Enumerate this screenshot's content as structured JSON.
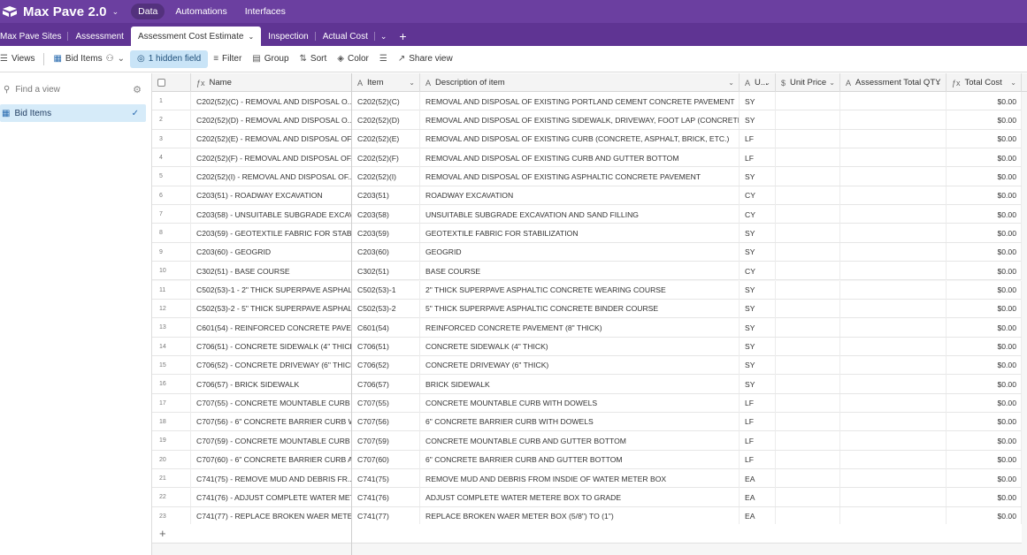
{
  "app": {
    "title": "Max Pave 2.0",
    "nav": [
      "Data",
      "Automations",
      "Interfaces"
    ],
    "active_nav": "Data"
  },
  "tabs": {
    "items": [
      "Max Pave Sites",
      "Assessment",
      "Assessment Cost Estimate",
      "Inspection",
      "Actual Cost"
    ],
    "active": "Assessment Cost Estimate"
  },
  "toolbar": {
    "views": "Views",
    "view_name": "Bid Items",
    "hidden": "1 hidden field",
    "filter": "Filter",
    "group": "Group",
    "sort": "Sort",
    "color": "Color",
    "share": "Share view"
  },
  "sidebar": {
    "search_placeholder": "Find a view",
    "view_item": "Bid Items"
  },
  "columns": {
    "name": "Name",
    "item": "Item",
    "description": "Description of item",
    "unit": "U...",
    "unit_price": "Unit Price",
    "qty": "Assessment Total QTY",
    "total": "Total Cost"
  },
  "rows": [
    {
      "n": "1",
      "name": "C202(52)(C) - REMOVAL AND DISPOSAL O...",
      "item": "C202(52)(C)",
      "desc": "REMOVAL AND DISPOSAL OF EXISTING PORTLAND CEMENT CONCRETE PAVEMENT",
      "unit": "SY",
      "cost": "$0.00"
    },
    {
      "n": "2",
      "name": "C202(52)(D) - REMOVAL AND DISPOSAL O...",
      "item": "C202(52)(D)",
      "desc": "REMOVAL AND DISPOSAL OF EXISTING SIDEWALK, DRIVEWAY, FOOT LAP (CONCRETE, BRI...",
      "unit": "SY",
      "cost": "$0.00"
    },
    {
      "n": "3",
      "name": "C202(52)(E) - REMOVAL AND DISPOSAL OF...",
      "item": "C202(52)(E)",
      "desc": "REMOVAL AND DISPOSAL OF EXISTING CURB (CONCRETE, ASPHALT, BRICK, ETC.)",
      "unit": "LF",
      "cost": "$0.00"
    },
    {
      "n": "4",
      "name": "C202(52)(F) - REMOVAL AND DISPOSAL OF...",
      "item": "C202(52)(F)",
      "desc": "REMOVAL AND DISPOSAL OF EXISTING CURB AND GUTTER BOTTOM",
      "unit": "LF",
      "cost": "$0.00"
    },
    {
      "n": "5",
      "name": "C202(52)(I) - REMOVAL AND DISPOSAL OF...",
      "item": "C202(52)(I)",
      "desc": "REMOVAL AND DISPOSAL OF EXISTING ASPHALTIC CONCRETE PAVEMENT",
      "unit": "SY",
      "cost": "$0.00"
    },
    {
      "n": "6",
      "name": "C203(51) - ROADWAY EXCAVATION",
      "item": "C203(51)",
      "desc": "ROADWAY EXCAVATION",
      "unit": "CY",
      "cost": "$0.00"
    },
    {
      "n": "7",
      "name": "C203(58) - UNSUITABLE SUBGRADE EXCAV...",
      "item": "C203(58)",
      "desc": "UNSUITABLE SUBGRADE EXCAVATION AND SAND FILLING",
      "unit": "CY",
      "cost": "$0.00"
    },
    {
      "n": "8",
      "name": "C203(59) - GEOTEXTILE FABRIC FOR STABIL...",
      "item": "C203(59)",
      "desc": "GEOTEXTILE FABRIC FOR STABILIZATION",
      "unit": "SY",
      "cost": "$0.00"
    },
    {
      "n": "9",
      "name": "C203(60) - GEOGRID",
      "item": "C203(60)",
      "desc": "GEOGRID",
      "unit": "SY",
      "cost": "$0.00"
    },
    {
      "n": "10",
      "name": "C302(51) - BASE COURSE",
      "item": "C302(51)",
      "desc": "BASE COURSE",
      "unit": "CY",
      "cost": "$0.00"
    },
    {
      "n": "11",
      "name": "C502(53)-1 - 2\" THICK SUPERPAVE ASPHAL...",
      "item": "C502(53)-1",
      "desc": "2\" THICK SUPERPAVE ASPHALTIC CONCRETE WEARING COURSE",
      "unit": "SY",
      "cost": "$0.00"
    },
    {
      "n": "12",
      "name": "C502(53)-2 - 5\" THICK SUPERPAVE ASPHAL...",
      "item": "C502(53)-2",
      "desc": "5\" THICK SUPERPAVE ASPHALTIC CONCRETE BINDER COURSE",
      "unit": "SY",
      "cost": "$0.00"
    },
    {
      "n": "13",
      "name": "C601(54) - REINFORCED CONCRETE PAVE...",
      "item": "C601(54)",
      "desc": "REINFORCED CONCRETE PAVEMENT (8\" THICK)",
      "unit": "SY",
      "cost": "$0.00"
    },
    {
      "n": "14",
      "name": "C706(51) - CONCRETE SIDEWALK (4\" THICK)",
      "item": "C706(51)",
      "desc": "CONCRETE SIDEWALK (4\" THICK)",
      "unit": "SY",
      "cost": "$0.00"
    },
    {
      "n": "15",
      "name": "C706(52) - CONCRETE DRIVEWAY (6\" THICK)",
      "item": "C706(52)",
      "desc": "CONCRETE DRIVEWAY (6\" THICK)",
      "unit": "SY",
      "cost": "$0.00"
    },
    {
      "n": "16",
      "name": "C706(57) - BRICK SIDEWALK",
      "item": "C706(57)",
      "desc": "BRICK SIDEWALK",
      "unit": "SY",
      "cost": "$0.00"
    },
    {
      "n": "17",
      "name": "C707(55) - CONCRETE MOUNTABLE CURB ...",
      "item": "C707(55)",
      "desc": "CONCRETE MOUNTABLE CURB WITH DOWELS",
      "unit": "LF",
      "cost": "$0.00"
    },
    {
      "n": "18",
      "name": "C707(56) - 6\" CONCRETE BARRIER CURB W...",
      "item": "C707(56)",
      "desc": "6\" CONCRETE BARRIER CURB WITH DOWELS",
      "unit": "LF",
      "cost": "$0.00"
    },
    {
      "n": "19",
      "name": "C707(59) - CONCRETE MOUNTABLE CURB ...",
      "item": "C707(59)",
      "desc": "CONCRETE MOUNTABLE CURB AND GUTTER BOTTOM",
      "unit": "LF",
      "cost": "$0.00"
    },
    {
      "n": "20",
      "name": "C707(60) - 6\" CONCRETE BARRIER CURB A...",
      "item": "C707(60)",
      "desc": "6\" CONCRETE BARRIER CURB AND GUTTER BOTTOM",
      "unit": "LF",
      "cost": "$0.00"
    },
    {
      "n": "21",
      "name": "C741(75) - REMOVE MUD AND DEBRIS FR...",
      "item": "C741(75)",
      "desc": "REMOVE MUD AND DEBRIS FROM INSDIE OF WATER METER BOX",
      "unit": "EA",
      "cost": "$0.00"
    },
    {
      "n": "22",
      "name": "C741(76) - ADJUST COMPLETE WATER MET...",
      "item": "C741(76)",
      "desc": "ADJUST COMPLETE WATER METERE BOX TO GRADE",
      "unit": "EA",
      "cost": "$0.00"
    },
    {
      "n": "23",
      "name": "C741(77) - REPLACE BROKEN WAER METE...",
      "item": "C741(77)",
      "desc": "REPLACE BROKEN WAER METER BOX (5/8\") TO (1\")",
      "unit": "EA",
      "cost": "$0.00"
    }
  ]
}
